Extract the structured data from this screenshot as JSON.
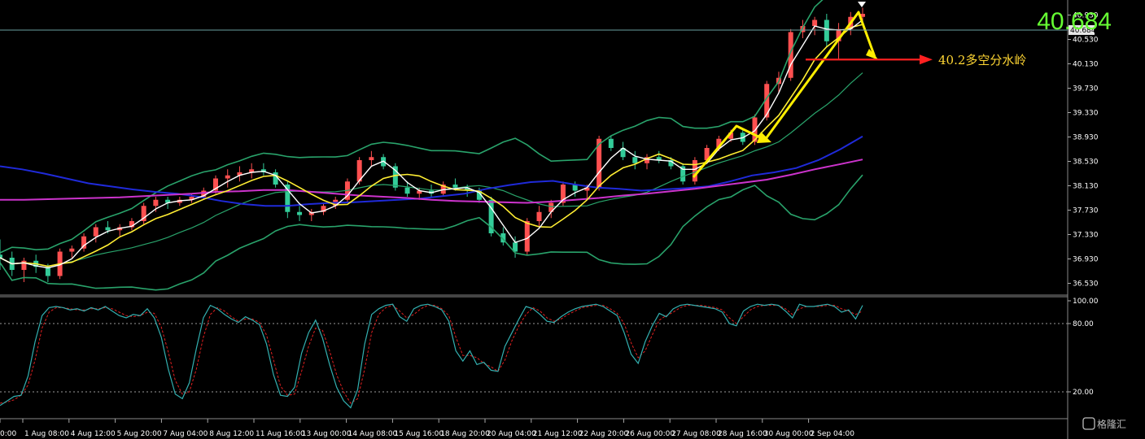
{
  "chart_data": {
    "type": "candlestick",
    "price_panel": {
      "ylim": [
        36.35,
        41.15
      ],
      "y_ticks": [
        "40.930",
        "40.530",
        "40.130",
        "39.730",
        "39.330",
        "38.930",
        "38.530",
        "38.130",
        "37.730",
        "37.330",
        "36.930",
        "36.530"
      ],
      "current_price": "40.684",
      "current_price_tag": "40.684",
      "candles": [
        [
          37.0,
          37.25,
          36.75,
          36.95
        ],
        [
          36.95,
          37.05,
          36.65,
          36.75
        ],
        [
          36.75,
          36.95,
          36.55,
          36.9
        ],
        [
          36.9,
          37.0,
          36.7,
          36.8
        ],
        [
          36.8,
          36.85,
          36.55,
          36.65
        ],
        [
          36.65,
          37.1,
          36.6,
          37.05
        ],
        [
          37.05,
          37.15,
          36.95,
          37.1
        ],
        [
          37.1,
          37.35,
          37.05,
          37.3
        ],
        [
          37.3,
          37.5,
          37.2,
          37.45
        ],
        [
          37.45,
          37.55,
          37.35,
          37.4
        ],
        [
          37.4,
          37.5,
          37.3,
          37.45
        ],
        [
          37.45,
          37.6,
          37.4,
          37.55
        ],
        [
          37.55,
          37.85,
          37.5,
          37.8
        ],
        [
          37.8,
          37.95,
          37.7,
          37.9
        ],
        [
          37.9,
          37.95,
          37.75,
          37.85
        ],
        [
          37.85,
          37.95,
          37.8,
          37.9
        ],
        [
          37.9,
          38.0,
          37.85,
          37.95
        ],
        [
          37.95,
          38.1,
          37.9,
          38.05
        ],
        [
          38.05,
          38.3,
          38.0,
          38.25
        ],
        [
          38.25,
          38.4,
          38.1,
          38.3
        ],
        [
          38.3,
          38.45,
          38.2,
          38.35
        ],
        [
          38.35,
          38.5,
          38.25,
          38.4
        ],
        [
          38.4,
          38.5,
          38.3,
          38.35
        ],
        [
          38.35,
          38.4,
          38.1,
          38.15
        ],
        [
          38.15,
          38.2,
          37.6,
          37.7
        ],
        [
          37.7,
          37.8,
          37.55,
          37.65
        ],
        [
          37.65,
          37.75,
          37.55,
          37.7
        ],
        [
          37.7,
          37.85,
          37.65,
          37.8
        ],
        [
          37.8,
          37.95,
          37.75,
          37.9
        ],
        [
          37.9,
          38.25,
          37.85,
          38.2
        ],
        [
          38.2,
          38.6,
          38.15,
          38.55
        ],
        [
          38.55,
          38.7,
          38.45,
          38.6
        ],
        [
          38.6,
          38.65,
          38.4,
          38.45
        ],
        [
          38.45,
          38.5,
          38.05,
          38.1
        ],
        [
          38.1,
          38.2,
          37.95,
          38.0
        ],
        [
          38.0,
          38.1,
          37.9,
          38.05
        ],
        [
          38.05,
          38.15,
          37.95,
          38.0
        ],
        [
          38.0,
          38.2,
          37.95,
          38.15
        ],
        [
          38.15,
          38.25,
          38.05,
          38.1
        ],
        [
          38.1,
          38.15,
          37.95,
          38.05
        ],
        [
          38.05,
          38.1,
          37.85,
          37.9
        ],
        [
          37.9,
          37.95,
          37.3,
          37.35
        ],
        [
          37.35,
          37.45,
          37.15,
          37.2
        ],
        [
          37.2,
          37.3,
          36.95,
          37.05
        ],
        [
          37.05,
          37.6,
          37.0,
          37.55
        ],
        [
          37.55,
          37.8,
          37.45,
          37.7
        ],
        [
          37.7,
          37.9,
          37.6,
          37.85
        ],
        [
          37.85,
          38.2,
          37.8,
          38.15
        ],
        [
          38.15,
          38.2,
          37.95,
          38.05
        ],
        [
          38.05,
          38.15,
          37.9,
          38.1
        ],
        [
          38.1,
          38.95,
          38.05,
          38.9
        ],
        [
          38.9,
          38.95,
          38.7,
          38.75
        ],
        [
          38.75,
          38.85,
          38.55,
          38.6
        ],
        [
          38.6,
          38.7,
          38.4,
          38.5
        ],
        [
          38.5,
          38.65,
          38.4,
          38.6
        ],
        [
          38.6,
          38.7,
          38.5,
          38.55
        ],
        [
          38.55,
          38.6,
          38.4,
          38.45
        ],
        [
          38.45,
          38.5,
          38.15,
          38.2
        ],
        [
          38.2,
          38.6,
          38.15,
          38.55
        ],
        [
          38.55,
          38.8,
          38.5,
          38.75
        ],
        [
          38.75,
          38.95,
          38.7,
          38.9
        ],
        [
          38.9,
          39.05,
          38.85,
          39.0
        ],
        [
          39.0,
          39.05,
          38.8,
          38.85
        ],
        [
          38.85,
          39.3,
          38.8,
          39.25
        ],
        [
          39.25,
          39.85,
          39.2,
          39.8
        ],
        [
          39.8,
          40.0,
          39.65,
          39.9
        ],
        [
          39.9,
          40.7,
          39.85,
          40.65
        ],
        [
          40.65,
          40.85,
          40.55,
          40.75
        ],
        [
          40.75,
          40.9,
          40.6,
          40.85
        ],
        [
          40.85,
          40.95,
          40.4,
          40.5
        ],
        [
          40.5,
          40.8,
          40.2,
          40.7
        ],
        [
          40.7,
          40.98,
          40.6,
          40.9
        ],
        [
          40.9,
          41.05,
          40.75,
          40.95
        ]
      ],
      "ma_slow_blue": [
        38.45,
        38.4,
        38.33,
        38.25,
        38.17,
        38.12,
        38.07,
        38.03,
        38.0,
        37.95,
        37.88,
        37.83,
        37.8,
        37.8,
        37.83,
        37.85,
        37.86,
        37.88,
        37.9,
        37.92,
        37.96,
        38.0,
        38.08,
        38.14,
        38.19,
        38.21,
        38.15,
        38.1,
        38.08,
        38.05,
        38.07,
        38.09,
        38.12,
        38.2,
        38.3,
        38.35,
        38.42,
        38.55,
        38.73,
        38.94
      ],
      "ma_magenta": [
        37.9,
        37.9,
        37.91,
        37.92,
        37.93,
        37.94,
        37.96,
        37.98,
        38.0,
        38.03,
        38.04,
        38.06,
        38.06,
        38.03,
        38.0,
        37.97,
        37.95,
        37.93,
        37.9,
        37.88,
        37.87,
        37.86,
        37.85,
        37.87,
        37.9,
        37.93,
        37.97,
        38.0,
        38.04,
        38.08,
        38.13,
        38.18,
        38.23,
        38.31,
        38.4,
        38.48,
        38.56
      ]
    },
    "annotation": "40.2多空分水岭",
    "stoch_panel": {
      "ylim": [
        0,
        100
      ],
      "y_ticks": [
        "100.00",
        "80.00",
        "20.00"
      ],
      "main": [
        8,
        12,
        16,
        17,
        34,
        64,
        87,
        94,
        95,
        94,
        92,
        93,
        91,
        94,
        92,
        95,
        91,
        87,
        85,
        88,
        87,
        93,
        85,
        68,
        40,
        18,
        14,
        28,
        58,
        85,
        96,
        93,
        88,
        84,
        81,
        86,
        83,
        79,
        62,
        35,
        17,
        16,
        24,
        54,
        72,
        83,
        67,
        44,
        24,
        12,
        6,
        22,
        62,
        88,
        93,
        96,
        97,
        86,
        82,
        93,
        96,
        97,
        95,
        92,
        82,
        56,
        47,
        56,
        44,
        46,
        39,
        38,
        60,
        72,
        84,
        95,
        93,
        88,
        82,
        81,
        86,
        90,
        93,
        95,
        96,
        97,
        95,
        91,
        87,
        72,
        53,
        45,
        64,
        78,
        89,
        86,
        93,
        96,
        97,
        96,
        95,
        94,
        93,
        90,
        80,
        78,
        91,
        95,
        97,
        96,
        97,
        96,
        91,
        85,
        97,
        95,
        95,
        96,
        97,
        95,
        90,
        92,
        84,
        96
      ],
      "signal": [
        10,
        11,
        13,
        17,
        26,
        48,
        76,
        90,
        94,
        94,
        93,
        92,
        92,
        93,
        93,
        94,
        93,
        90,
        87,
        86,
        87,
        90,
        89,
        77,
        55,
        30,
        18,
        20,
        40,
        68,
        88,
        94,
        91,
        86,
        82,
        84,
        84,
        81,
        70,
        48,
        25,
        17,
        18,
        38,
        60,
        76,
        74,
        56,
        35,
        20,
        10,
        14,
        40,
        72,
        88,
        94,
        96,
        91,
        85,
        88,
        93,
        96,
        96,
        93,
        87,
        68,
        52,
        52,
        50,
        45,
        42,
        38,
        48,
        65,
        78,
        88,
        94,
        91,
        85,
        82,
        84,
        88,
        91,
        94,
        95,
        96,
        96,
        93,
        89,
        80,
        63,
        50,
        56,
        70,
        83,
        87,
        90,
        94,
        96,
        96,
        96,
        95,
        94,
        92,
        85,
        80,
        86,
        92,
        95,
        96,
        96,
        96,
        93,
        88,
        93,
        95,
        95,
        95,
        96,
        96,
        93,
        91,
        88,
        91
      ]
    },
    "x_ticks": [
      "0:00",
      "1 Aug 08:00",
      "4 Aug 12:00",
      "5 Aug 20:00",
      "7 Aug 04:00",
      "8 Aug 12:00",
      "11 Aug 16:00",
      "13 Aug 00:00",
      "14 Aug 08:00",
      "15 Aug 16:00",
      "18 Aug 20:00",
      "20 Aug 04:00",
      "21 Aug 12:00",
      "22 Aug 20:00",
      "26 Aug 00:00",
      "27 Aug 08:00",
      "28 Aug 16:00",
      "30 Aug 00:00",
      "2 Sep 04:00"
    ]
  },
  "watermark": "格隆汇",
  "colors": {
    "bull": "#ff5050",
    "bear": "#33cc99",
    "bollinger": "#29a36b",
    "ma_white": "#ffffff",
    "ma_yellow": "#ffee33",
    "ma_blue": "#1f2ad9",
    "ma_magenta": "#cc33cc",
    "stoch_main": "#33b0b0",
    "stoch_signal": "#e02020",
    "arrow_red": "#ff2020",
    "arrow_yellow": "#ffee00",
    "price_big": "#66ff33",
    "price_line": "#6aa0a0"
  }
}
